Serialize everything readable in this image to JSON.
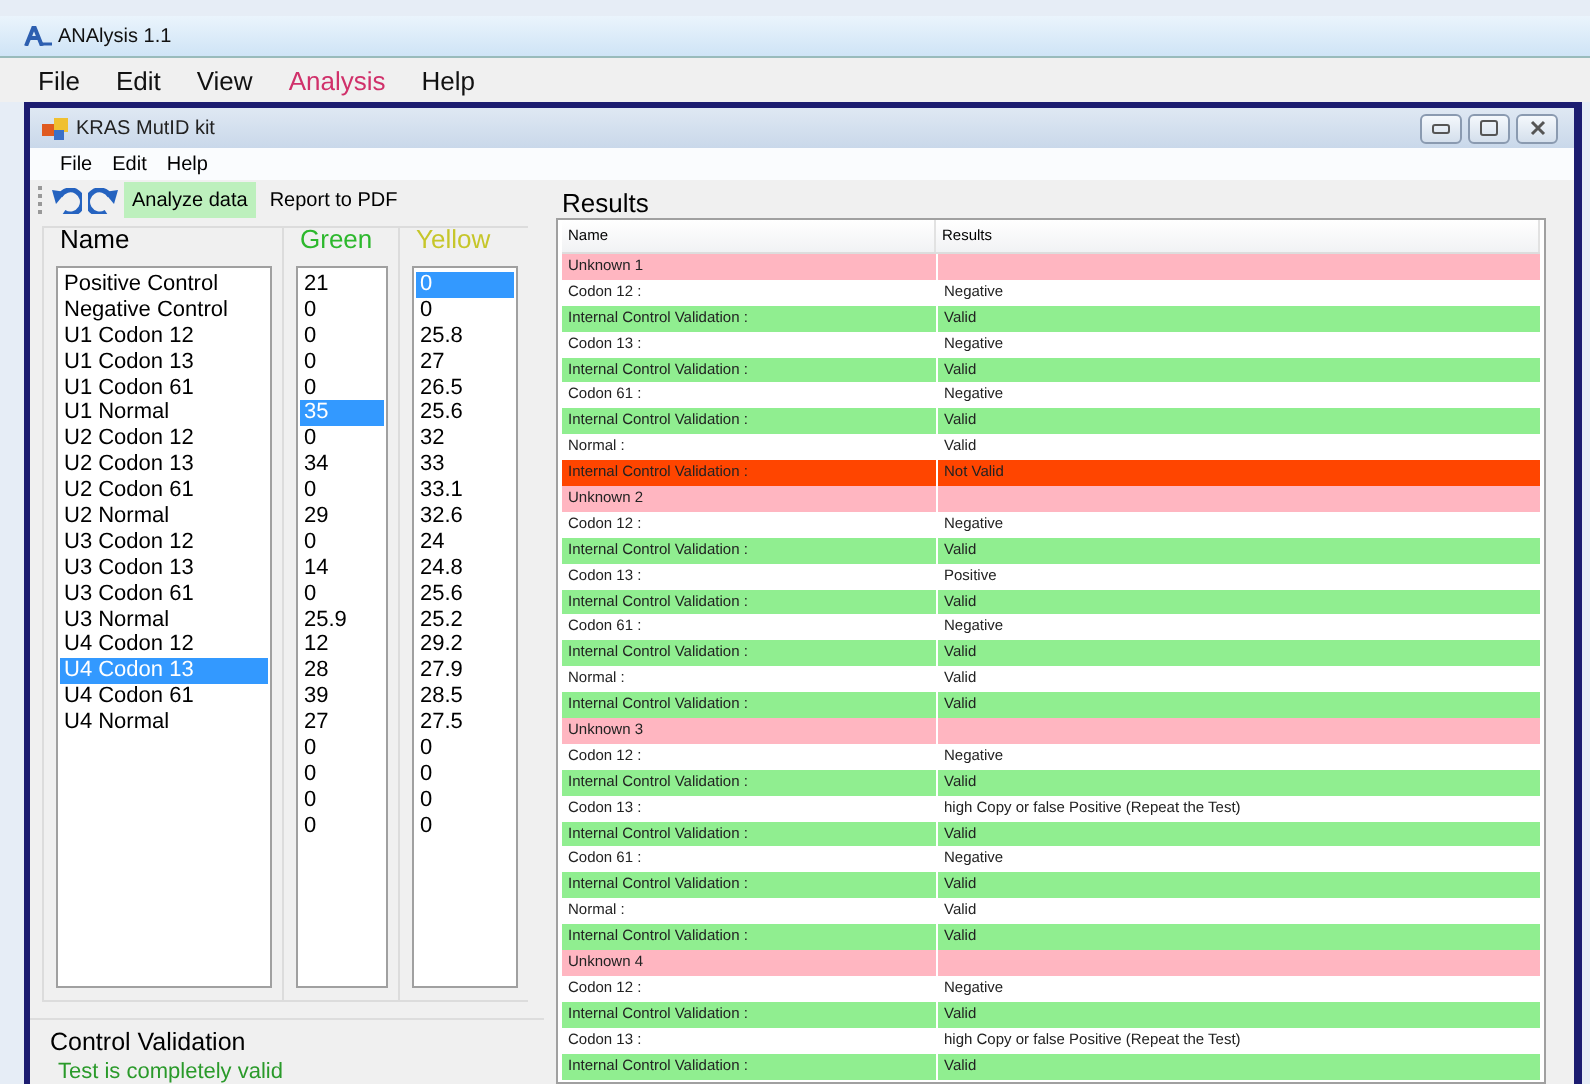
{
  "app": {
    "title": "ANAlysis 1.1",
    "menu": [
      {
        "label": "File",
        "selected": false
      },
      {
        "label": "Edit",
        "selected": false
      },
      {
        "label": "View",
        "selected": false
      },
      {
        "label": "Analysis",
        "selected": true
      },
      {
        "label": "Help",
        "selected": false
      }
    ]
  },
  "window": {
    "title": "KRAS MutID kit",
    "menu": [
      "File",
      "Edit",
      "Help"
    ],
    "toolbar": [
      {
        "label": "Analyze data",
        "kind": "primary"
      },
      {
        "label": "Report to PDF",
        "kind": "plain"
      }
    ]
  },
  "lists": [
    {
      "title": "Name",
      "kind": "name",
      "items": [
        {
          "text": "Positive Control",
          "selected": false
        },
        {
          "text": "Negative Control",
          "selected": false
        },
        {
          "text": "U1 Codon 12",
          "selected": false
        },
        {
          "text": "U1 Codon 13",
          "selected": false
        },
        {
          "text": "U1 Codon 61",
          "selected": false
        },
        {
          "text": "U1 Normal",
          "selected": false
        },
        {
          "text": "U2 Codon 12",
          "selected": false
        },
        {
          "text": "U2 Codon 13",
          "selected": false
        },
        {
          "text": "U2 Codon 61",
          "selected": false
        },
        {
          "text": "U2 Normal",
          "selected": false
        },
        {
          "text": "U3 Codon 12",
          "selected": false
        },
        {
          "text": "U3 Codon 13",
          "selected": false
        },
        {
          "text": "U3 Codon 61",
          "selected": false
        },
        {
          "text": "U3 Normal",
          "selected": false
        },
        {
          "text": "U4 Codon 12",
          "selected": false
        },
        {
          "text": "U4 Codon 13",
          "selected": true
        },
        {
          "text": "U4 Codon 61",
          "selected": false
        },
        {
          "text": "U4 Normal",
          "selected": false
        }
      ]
    },
    {
      "title": "Green",
      "kind": "green",
      "items": [
        {
          "text": "21",
          "selected": false
        },
        {
          "text": "0",
          "selected": false
        },
        {
          "text": "0",
          "selected": false
        },
        {
          "text": "0",
          "selected": false
        },
        {
          "text": "0",
          "selected": false
        },
        {
          "text": "35",
          "selected": true
        },
        {
          "text": "0",
          "selected": false
        },
        {
          "text": "34",
          "selected": false
        },
        {
          "text": "0",
          "selected": false
        },
        {
          "text": "29",
          "selected": false
        },
        {
          "text": "0",
          "selected": false
        },
        {
          "text": "14",
          "selected": false
        },
        {
          "text": "0",
          "selected": false
        },
        {
          "text": "25.9",
          "selected": false
        },
        {
          "text": "12",
          "selected": false
        },
        {
          "text": "28",
          "selected": false
        },
        {
          "text": "39",
          "selected": false
        },
        {
          "text": "27",
          "selected": false
        },
        {
          "text": "0",
          "selected": false
        },
        {
          "text": "0",
          "selected": false
        },
        {
          "text": "0",
          "selected": false
        },
        {
          "text": "0",
          "selected": false
        }
      ]
    },
    {
      "title": "Yellow",
      "kind": "yellow",
      "items": [
        {
          "text": "0",
          "selected": true
        },
        {
          "text": "0",
          "selected": false
        },
        {
          "text": "25.8",
          "selected": false
        },
        {
          "text": "27",
          "selected": false
        },
        {
          "text": "26.5",
          "selected": false
        },
        {
          "text": "25.6",
          "selected": false
        },
        {
          "text": "32",
          "selected": false
        },
        {
          "text": "33",
          "selected": false
        },
        {
          "text": "33.1",
          "selected": false
        },
        {
          "text": "32.6",
          "selected": false
        },
        {
          "text": "24",
          "selected": false
        },
        {
          "text": "24.8",
          "selected": false
        },
        {
          "text": "25.6",
          "selected": false
        },
        {
          "text": "25.2",
          "selected": false
        },
        {
          "text": "29.2",
          "selected": false
        },
        {
          "text": "27.9",
          "selected": false
        },
        {
          "text": "28.5",
          "selected": false
        },
        {
          "text": "27.5",
          "selected": false
        },
        {
          "text": "0",
          "selected": false
        },
        {
          "text": "0",
          "selected": false
        },
        {
          "text": "0",
          "selected": false
        },
        {
          "text": "0",
          "selected": false
        }
      ]
    }
  ],
  "control_validation": {
    "title": "Control Validation",
    "message": "Test is completely valid"
  },
  "results": {
    "title": "Results",
    "columns": [
      "Name",
      "Results"
    ],
    "rows": [
      {
        "kind": "sample",
        "name": "Unknown 1"
      },
      {
        "kind": "info",
        "name": "Codon 12 :",
        "result": "Negative"
      },
      {
        "kind": "valid",
        "name": "Internal Control Validation :",
        "result": "Valid"
      },
      {
        "kind": "info",
        "name": "Codon 13 :",
        "result": "Negative"
      },
      {
        "kind": "valid",
        "name": "Internal Control Validation :",
        "result": "Valid"
      },
      {
        "kind": "info",
        "name": "Codon 61 :",
        "result": "Negative"
      },
      {
        "kind": "valid",
        "name": "Internal Control Validation :",
        "result": "Valid"
      },
      {
        "kind": "info",
        "name": "Normal :",
        "result": "Valid"
      },
      {
        "kind": "invalid",
        "name": "Internal Control Validation :",
        "result": "Not Valid"
      },
      {
        "kind": "sample",
        "name": "Unknown 2"
      },
      {
        "kind": "info",
        "name": "Codon 12 :",
        "result": "Negative"
      },
      {
        "kind": "valid",
        "name": "Internal Control Validation :",
        "result": "Valid"
      },
      {
        "kind": "info",
        "name": "Codon 13 :",
        "result": "Positive"
      },
      {
        "kind": "valid",
        "name": "Internal Control Validation :",
        "result": "Valid"
      },
      {
        "kind": "info",
        "name": "Codon 61 :",
        "result": "Negative"
      },
      {
        "kind": "valid",
        "name": "Internal Control Validation :",
        "result": "Valid"
      },
      {
        "kind": "info",
        "name": "Normal :",
        "result": "Valid"
      },
      {
        "kind": "valid",
        "name": "Internal Control Validation :",
        "result": "Valid"
      },
      {
        "kind": "sample",
        "name": "Unknown 3"
      },
      {
        "kind": "info",
        "name": "Codon 12 :",
        "result": "Negative"
      },
      {
        "kind": "valid",
        "name": "Internal Control Validation :",
        "result": "Valid"
      },
      {
        "kind": "info",
        "name": "Codon 13 :",
        "result": "high Copy or false Positive (Repeat the Test)"
      },
      {
        "kind": "valid",
        "name": "Internal Control Validation :",
        "result": "Valid"
      },
      {
        "kind": "info",
        "name": "Codon 61 :",
        "result": "Negative"
      },
      {
        "kind": "valid",
        "name": "Internal Control Validation :",
        "result": "Valid"
      },
      {
        "kind": "info",
        "name": "Normal :",
        "result": "Valid"
      },
      {
        "kind": "valid",
        "name": "Internal Control Validation :",
        "result": "Valid"
      },
      {
        "kind": "sample",
        "name": "Unknown 4"
      },
      {
        "kind": "info",
        "name": "Codon 12 :",
        "result": "Negative"
      },
      {
        "kind": "valid",
        "name": "Internal Control Validation :",
        "result": "Valid"
      },
      {
        "kind": "info",
        "name": "Codon 13 :",
        "result": "high Copy or false Positive (Repeat the Test)"
      },
      {
        "kind": "valid",
        "name": "Internal Control Validation :",
        "result": "Valid"
      }
    ]
  }
}
